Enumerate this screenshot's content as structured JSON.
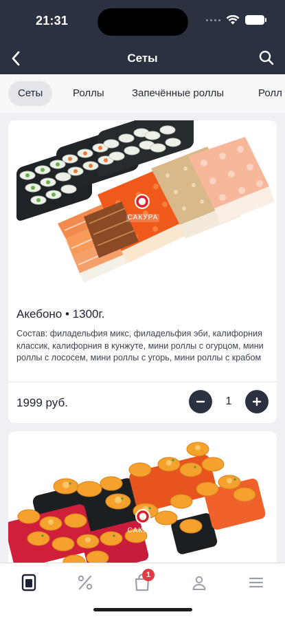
{
  "status_bar": {
    "time": "21:31"
  },
  "header": {
    "title": "Сеты"
  },
  "tabs": [
    {
      "label": "Сеты",
      "active": true
    },
    {
      "label": "Роллы",
      "active": false
    },
    {
      "label": "Запечённые роллы",
      "active": false
    },
    {
      "label": "Ролл",
      "active": false
    }
  ],
  "products": [
    {
      "name": "Акебоно • 1300г.",
      "description": "Состав: филадельфия микс, филадельфия эби, калифорния классик, калифорния в кунжуте, мини роллы с огурцом, мини роллы с лососем, мини роллы с угорь, мини роллы с крабом",
      "price": "1999 руб.",
      "quantity": "1",
      "logo_text": "САКУРА"
    },
    {
      "logo_text": "САКУРА"
    }
  ],
  "bottom_nav": {
    "items": [
      {
        "icon": "menu-card-icon",
        "active": true
      },
      {
        "icon": "percent-icon",
        "active": false
      },
      {
        "icon": "cart-icon",
        "badge": "1",
        "active": false
      },
      {
        "icon": "profile-icon",
        "active": false
      },
      {
        "icon": "hamburger-icon",
        "active": false
      }
    ]
  },
  "colors": {
    "header_bg": "#2a3140",
    "accent_dark": "#2a3140",
    "badge_red": "#e53945",
    "logo_red": "#d8202b"
  }
}
